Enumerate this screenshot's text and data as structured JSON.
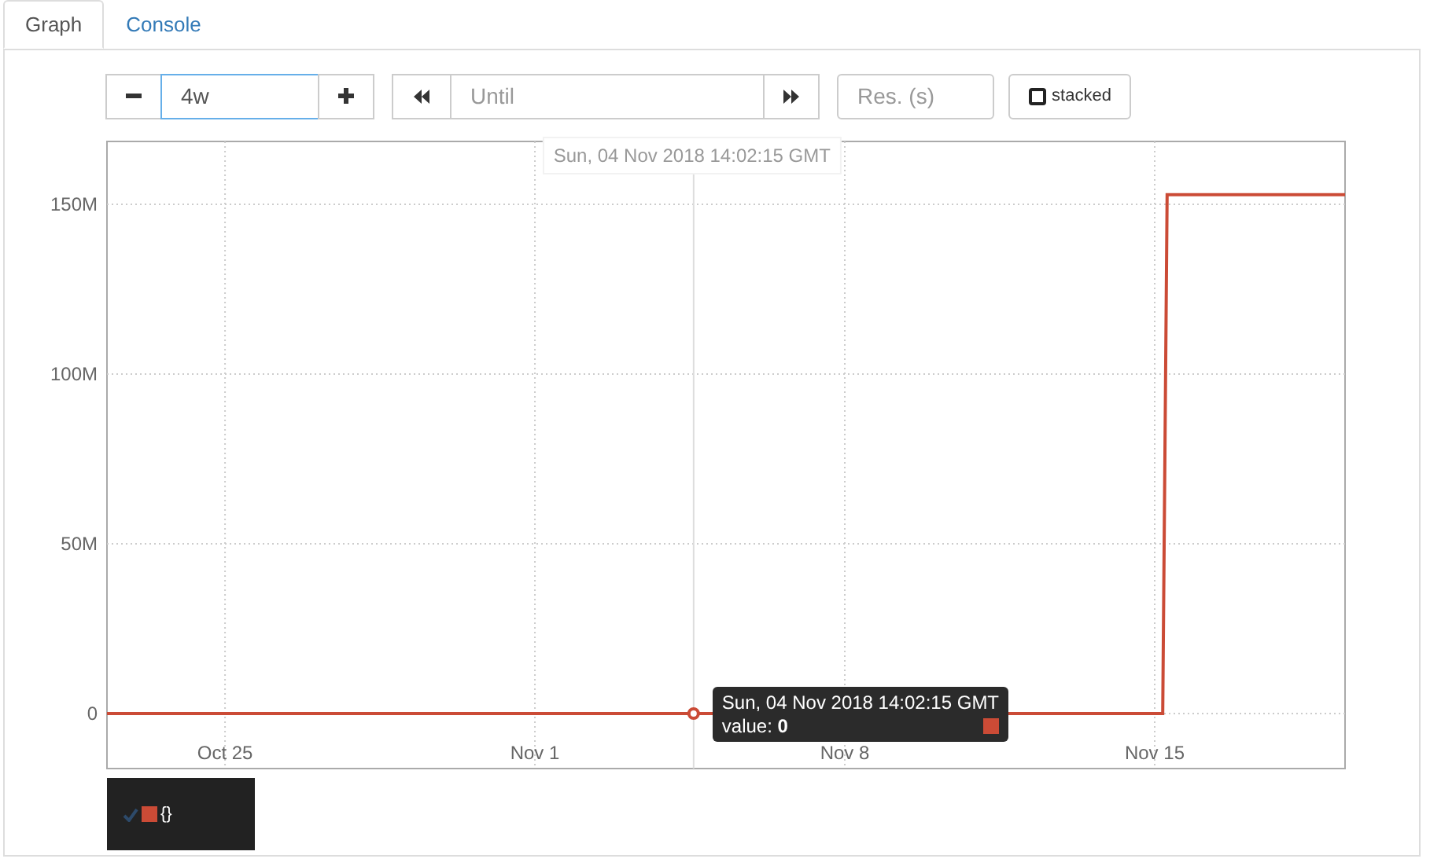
{
  "tabs": [
    {
      "label": "Graph",
      "selected": true
    },
    {
      "label": "Console",
      "selected": false
    }
  ],
  "controls": {
    "range": {
      "value": "4w",
      "focused": true
    },
    "until": {
      "placeholder": "Until"
    },
    "resolution": {
      "placeholder": "Res. (s)"
    },
    "stacked": {
      "label": "stacked",
      "checked": false
    }
  },
  "graph": {
    "chart_data": {
      "type": "line",
      "grid": true,
      "ref_lines": [
        {
          "axis": "x",
          "value": "2018-11-04T14:02:15Z"
        }
      ],
      "xlim": [
        "2018-10-22T08:00:00Z",
        "2018-11-19T07:12:00Z"
      ],
      "ylim": [
        -16200000,
        168500000
      ],
      "xticks": [
        {
          "value": "2018-10-25T00:00:00Z",
          "label": "Oct 25"
        },
        {
          "value": "2018-11-01T00:00:00Z",
          "label": "Nov 1"
        },
        {
          "value": "2018-11-08T00:00:00Z",
          "label": "Nov 8"
        },
        {
          "value": "2018-11-15T00:00:00Z",
          "label": "Nov 15"
        }
      ],
      "yticks": [
        {
          "value": 0,
          "label": "0"
        },
        {
          "value": 50000000,
          "label": "50M"
        },
        {
          "value": 100000000,
          "label": "100M"
        },
        {
          "value": 150000000,
          "label": "150M"
        }
      ],
      "x": [
        "2018-10-22T08:00:00Z",
        "2018-11-15T04:19:00Z",
        "2018-11-15T06:43:00Z",
        "2018-11-19T07:12:00Z"
      ],
      "series": [
        {
          "name": "{}",
          "color": "#cb4b36",
          "values": [
            0,
            0,
            152800000,
            152800000
          ]
        }
      ]
    },
    "hover": {
      "axis_label": "Sun, 04 Nov 2018 14:02:15 GMT",
      "tooltip_time": "Sun, 04 Nov 2018 14:02:15 GMT",
      "tooltip_value": "value: **0**"
    },
    "legend": [
      {
        "shown": true
      }
    ]
  }
}
